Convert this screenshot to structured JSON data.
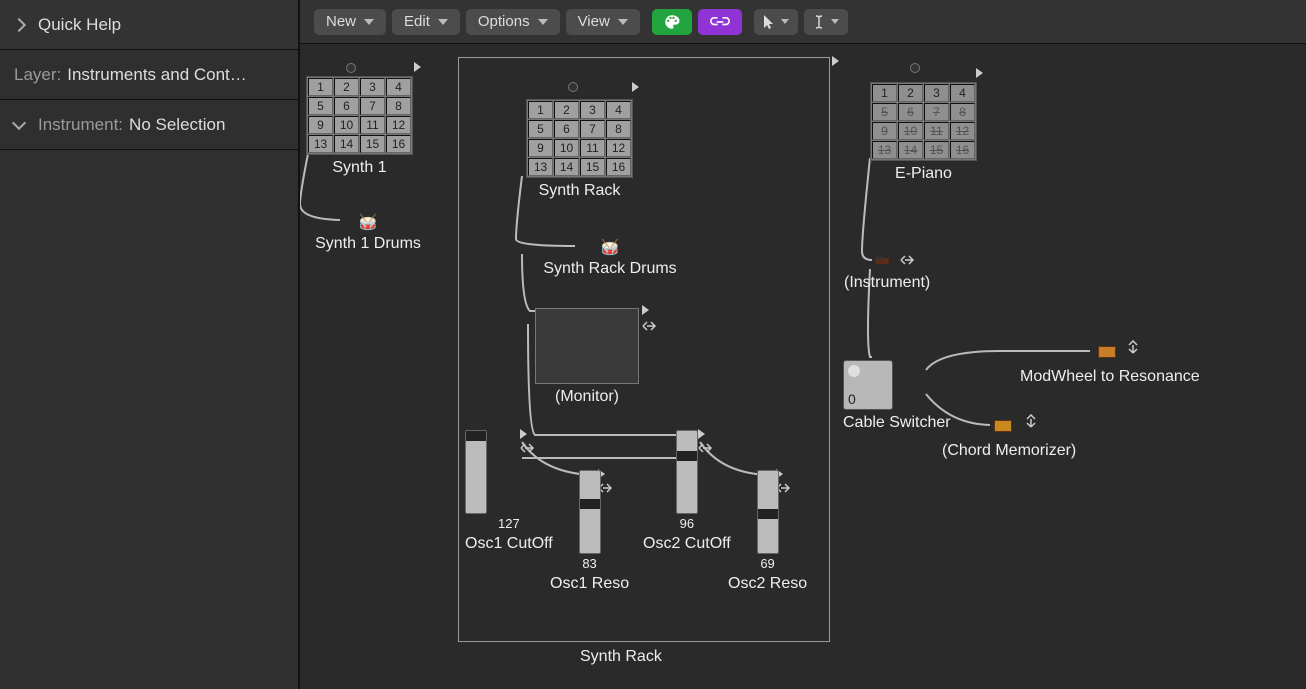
{
  "sidebar": {
    "quick_help": "Quick Help",
    "layer_label": "Layer:",
    "layer_value": "Instruments and Contr…",
    "instr_label": "Instrument:",
    "instr_value": "No Selection"
  },
  "menus": {
    "new": "New",
    "edit": "Edit",
    "options": "Options",
    "view": "View"
  },
  "objects": {
    "synth1": {
      "label": "Synth 1",
      "cells": [
        "1",
        "2",
        "3",
        "4",
        "5",
        "6",
        "7",
        "8",
        "9",
        "10",
        "11",
        "12",
        "13",
        "14",
        "15",
        "16"
      ]
    },
    "synth1_drums": {
      "label": "Synth 1 Drums"
    },
    "synth_rack": {
      "label": "Synth Rack",
      "cells": [
        "1",
        "2",
        "3",
        "4",
        "5",
        "6",
        "7",
        "8",
        "9",
        "10",
        "11",
        "12",
        "13",
        "14",
        "15",
        "16"
      ]
    },
    "synth_rack_drums": {
      "label": "Synth Rack Drums"
    },
    "monitor": {
      "label": "(Monitor)"
    },
    "osc1_cutoff": {
      "label": "Osc1 CutOff",
      "value": "127"
    },
    "osc1_reso": {
      "label": "Osc1 Reso",
      "value": "83"
    },
    "osc2_cutoff": {
      "label": "Osc2 CutOff",
      "value": "96"
    },
    "osc2_reso": {
      "label": "Osc2 Reso",
      "value": "69"
    },
    "epiano": {
      "label": "E-Piano",
      "cells": [
        "1",
        "2",
        "3",
        "4",
        "5",
        "6",
        "7",
        "8",
        "9",
        "10",
        "11",
        "12",
        "13",
        "14",
        "15",
        "16"
      ]
    },
    "instrument": {
      "label": "(Instrument)"
    },
    "cable_switcher": {
      "label": "Cable Switcher",
      "value": "0"
    },
    "modwheel": {
      "label": "ModWheel to Resonance"
    },
    "chord_mem": {
      "label": "(Chord Memorizer)"
    },
    "synth_rack_group": {
      "label": "Synth Rack"
    }
  }
}
